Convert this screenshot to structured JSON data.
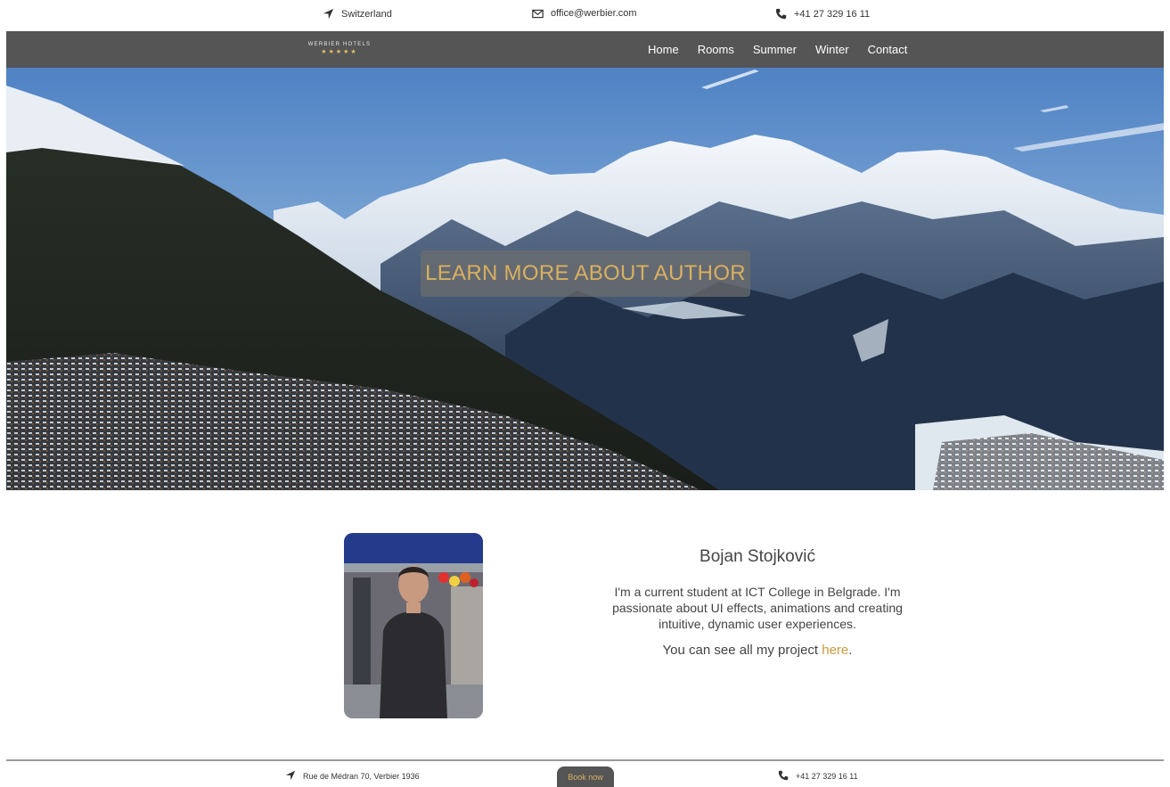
{
  "topbar": {
    "location": "Switzerland",
    "email": "office@werbier.com",
    "phone": "+41 27 329 16 11"
  },
  "nav": {
    "logo_name": "WERBIER HOTELS",
    "logo_stars": "★★★★★",
    "items": [
      "Home",
      "Rooms",
      "Summer",
      "Winter",
      "Contact"
    ]
  },
  "hero": {
    "button_label": "LEARN MORE ABOUT AUTHOR"
  },
  "author": {
    "name": "Bojan Stojković",
    "bio": "I'm a current student at ICT College in Belgrade. I'm passionate about UI effects, animations and creating intuitive, dynamic user experiences.",
    "project_text": "You can see all my project ",
    "project_link": "here",
    "project_end": "."
  },
  "footer": {
    "address": "Rue de Médran 70, Verbier 1936",
    "book_label": "Book now",
    "phone": "+41 27 329 16 11"
  },
  "colors": {
    "accent": "#c89b3c",
    "nav_bg": "#555556"
  }
}
